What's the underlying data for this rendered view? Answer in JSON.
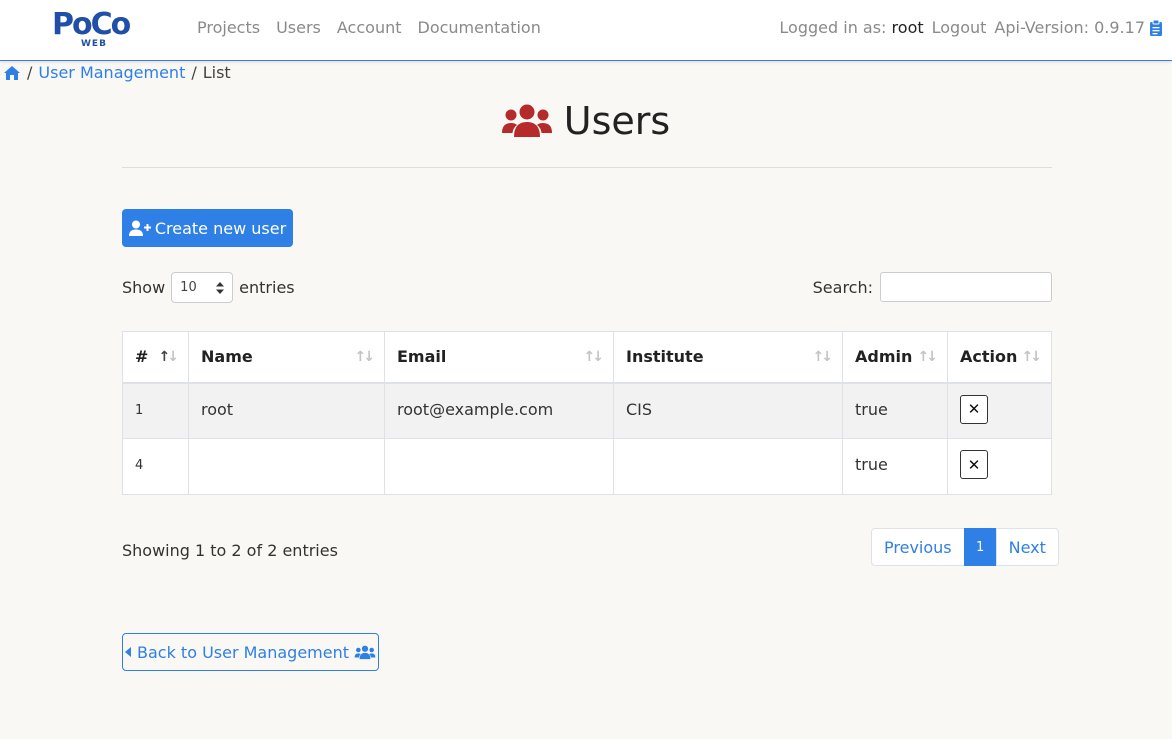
{
  "app": {
    "logo_text": "PoCo",
    "logo_subtext": "WEB"
  },
  "nav": {
    "links": [
      "Projects",
      "Users",
      "Account",
      "Documentation"
    ],
    "logged_in_label": "Logged in as:",
    "user": "root",
    "logout": "Logout",
    "api_version": "Api-Version: 0.9.17"
  },
  "breadcrumb": {
    "sep": "/",
    "link": "User Management",
    "current": "List"
  },
  "page": {
    "title": "Users"
  },
  "actions": {
    "create_label": "Create new user",
    "back_label": "Back to User Management"
  },
  "table_controls": {
    "show_label": "Show",
    "entries_label": "entries",
    "page_size": "10",
    "search_label": "Search:"
  },
  "table": {
    "headers": [
      "#",
      "Name",
      "Email",
      "Institute",
      "Admin",
      "Action"
    ],
    "rows": [
      {
        "id": "1",
        "name": "root",
        "email": "root@example.com",
        "institute": "CIS",
        "admin": "true"
      },
      {
        "id": "4",
        "name": "",
        "email": "",
        "institute": "",
        "admin": "true"
      }
    ]
  },
  "footer": {
    "info": "Showing 1 to 2 of 2 entries",
    "prev": "Previous",
    "page": "1",
    "next": "Next"
  },
  "colors": {
    "accent": "#2e7fe6",
    "icon_red": "#b52a2a",
    "logo_blue": "#1f4fa6"
  },
  "icons": {
    "home": "home-icon",
    "users": "users-icon",
    "user_plus": "user-plus-icon",
    "clipboard": "clipboard-icon",
    "close": "close-icon",
    "caret_left": "caret-left-icon"
  }
}
